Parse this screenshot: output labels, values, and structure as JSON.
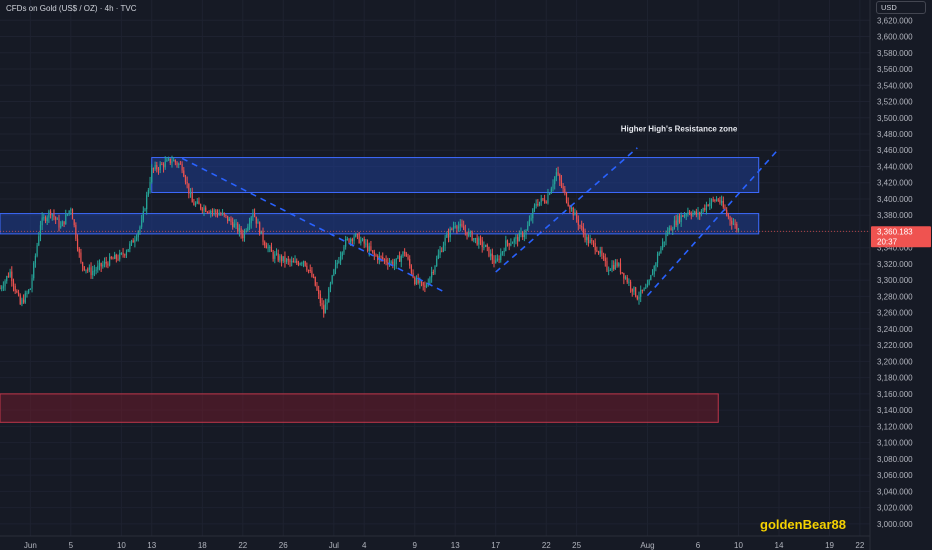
{
  "header": {
    "symbol_line": "CFDs on Gold (US$ / OZ) · 4h · TVC",
    "currency_button": "USD"
  },
  "watermark": "goldenBear88",
  "colors": {
    "background": "#161a25",
    "grid": "#1e2230",
    "up": "#26a69a",
    "down": "#ef5350",
    "zone_blue": "#1e3a8a",
    "zone_red": "#6b1c2c",
    "trendline": "#2962ff",
    "axis_text": "#b2b5be",
    "price_label": "#ef5350"
  },
  "chart_data": {
    "type": "candlestick",
    "title": "CFDs on Gold (US$ / OZ) · 4h · TVC",
    "y_axis": {
      "ylim": [
        2985,
        3645
      ],
      "ticks": [
        3000,
        3020,
        3040,
        3060,
        3080,
        3100,
        3120,
        3140,
        3160,
        3180,
        3200,
        3220,
        3240,
        3260,
        3280,
        3300,
        3320,
        3340,
        3360,
        3380,
        3400,
        3420,
        3440,
        3460,
        3480,
        3500,
        3520,
        3540,
        3560,
        3580,
        3600,
        3620
      ],
      "tick_labels": [
        "3,000.000",
        "3,020.000",
        "3,040.000",
        "3,060.000",
        "3,080.000",
        "3,100.000",
        "3,120.000",
        "3,140.000",
        "3,160.000",
        "3,180.000",
        "3,200.000",
        "3,220.000",
        "3,240.000",
        "3,260.000",
        "3,280.000",
        "3,300.000",
        "3,320.000",
        "3,340.000",
        "3,360.000",
        "3,380.000",
        "3,400.000",
        "3,420.000",
        "3,440.000",
        "3,460.000",
        "3,480.000",
        "3,500.000",
        "3,520.000",
        "3,540.000",
        "3,560.000",
        "3,580.000",
        "3,600.000",
        "3,620.000"
      ]
    },
    "x_axis": {
      "tick_labels": [
        "Jun",
        "5",
        "10",
        "13",
        "18",
        "22",
        "26",
        "Jul",
        "4",
        "9",
        "13",
        "17",
        "22",
        "25",
        "Aug",
        "6",
        "10",
        "14",
        "19",
        "22"
      ],
      "date_range": [
        "2025-05-29",
        "2025-08-23"
      ]
    },
    "grid": true,
    "current_price": {
      "value": 3360.183,
      "label": "3,360.183",
      "countdown": "20:37"
    },
    "zones": [
      {
        "type": "resistance",
        "color": "blue",
        "from": "2025-06-13",
        "to": "2025-08-12",
        "low": 3408,
        "high": 3451,
        "label": "Higher High's Resistance zone"
      },
      {
        "type": "support-resistance",
        "color": "blue",
        "from": "2025-05-29",
        "to": "2025-08-12",
        "low": 3357,
        "high": 3382
      },
      {
        "type": "support",
        "color": "red",
        "from": "2025-05-29",
        "to": "2025-08-08",
        "low": 3125,
        "high": 3160
      }
    ],
    "trendlines": [
      {
        "from": [
          "2025-06-16",
          3450
        ],
        "to": [
          "2025-07-12",
          3285
        ]
      },
      {
        "from": [
          "2025-07-17",
          3310
        ],
        "to": [
          "2025-07-31",
          3463
        ]
      },
      {
        "from": [
          "2025-08-01",
          3281
        ],
        "to": [
          "2025-08-14",
          3462
        ]
      }
    ],
    "price_path": [
      [
        "2025-05-29",
        3290
      ],
      [
        "2025-05-30",
        3310
      ],
      [
        "2025-05-31",
        3270
      ],
      [
        "2025-06-01",
        3290
      ],
      [
        "2025-06-02",
        3370
      ],
      [
        "2025-06-03",
        3385
      ],
      [
        "2025-06-04",
        3365
      ],
      [
        "2025-06-05",
        3390
      ],
      [
        "2025-06-06",
        3320
      ],
      [
        "2025-06-07",
        3310
      ],
      [
        "2025-06-09",
        3325
      ],
      [
        "2025-06-10",
        3330
      ],
      [
        "2025-06-11",
        3345
      ],
      [
        "2025-06-12",
        3370
      ],
      [
        "2025-06-13",
        3435
      ],
      [
        "2025-06-15",
        3448
      ],
      [
        "2025-06-16",
        3440
      ],
      [
        "2025-06-17",
        3395
      ],
      [
        "2025-06-19",
        3385
      ],
      [
        "2025-06-20",
        3380
      ],
      [
        "2025-06-21",
        3370
      ],
      [
        "2025-06-22",
        3355
      ],
      [
        "2025-06-23",
        3385
      ],
      [
        "2025-06-24",
        3350
      ],
      [
        "2025-06-25",
        3330
      ],
      [
        "2025-06-27",
        3320
      ],
      [
        "2025-06-28",
        3325
      ],
      [
        "2025-06-29",
        3300
      ],
      [
        "2025-06-30",
        3260
      ],
      [
        "2025-07-01",
        3310
      ],
      [
        "2025-07-02",
        3345
      ],
      [
        "2025-07-03",
        3355
      ],
      [
        "2025-07-04",
        3345
      ],
      [
        "2025-07-05",
        3330
      ],
      [
        "2025-07-07",
        3320
      ],
      [
        "2025-07-08",
        3335
      ],
      [
        "2025-07-09",
        3300
      ],
      [
        "2025-07-10",
        3290
      ],
      [
        "2025-07-11",
        3320
      ],
      [
        "2025-07-12",
        3350
      ],
      [
        "2025-07-13",
        3370
      ],
      [
        "2025-07-14",
        3360
      ],
      [
        "2025-07-15",
        3350
      ],
      [
        "2025-07-16",
        3340
      ],
      [
        "2025-07-17",
        3320
      ],
      [
        "2025-07-18",
        3345
      ],
      [
        "2025-07-19",
        3350
      ],
      [
        "2025-07-20",
        3360
      ],
      [
        "2025-07-21",
        3395
      ],
      [
        "2025-07-22",
        3400
      ],
      [
        "2025-07-23",
        3432
      ],
      [
        "2025-07-24",
        3400
      ],
      [
        "2025-07-25",
        3375
      ],
      [
        "2025-07-26",
        3350
      ],
      [
        "2025-07-27",
        3340
      ],
      [
        "2025-07-28",
        3315
      ],
      [
        "2025-07-29",
        3320
      ],
      [
        "2025-07-30",
        3300
      ],
      [
        "2025-07-31",
        3280
      ],
      [
        "2025-08-01",
        3290
      ],
      [
        "2025-08-02",
        3330
      ],
      [
        "2025-08-03",
        3360
      ],
      [
        "2025-08-04",
        3375
      ],
      [
        "2025-08-05",
        3385
      ],
      [
        "2025-08-06",
        3380
      ],
      [
        "2025-08-07",
        3395
      ],
      [
        "2025-08-08",
        3400
      ],
      [
        "2025-08-09",
        3378
      ],
      [
        "2025-08-10",
        3362
      ]
    ]
  }
}
